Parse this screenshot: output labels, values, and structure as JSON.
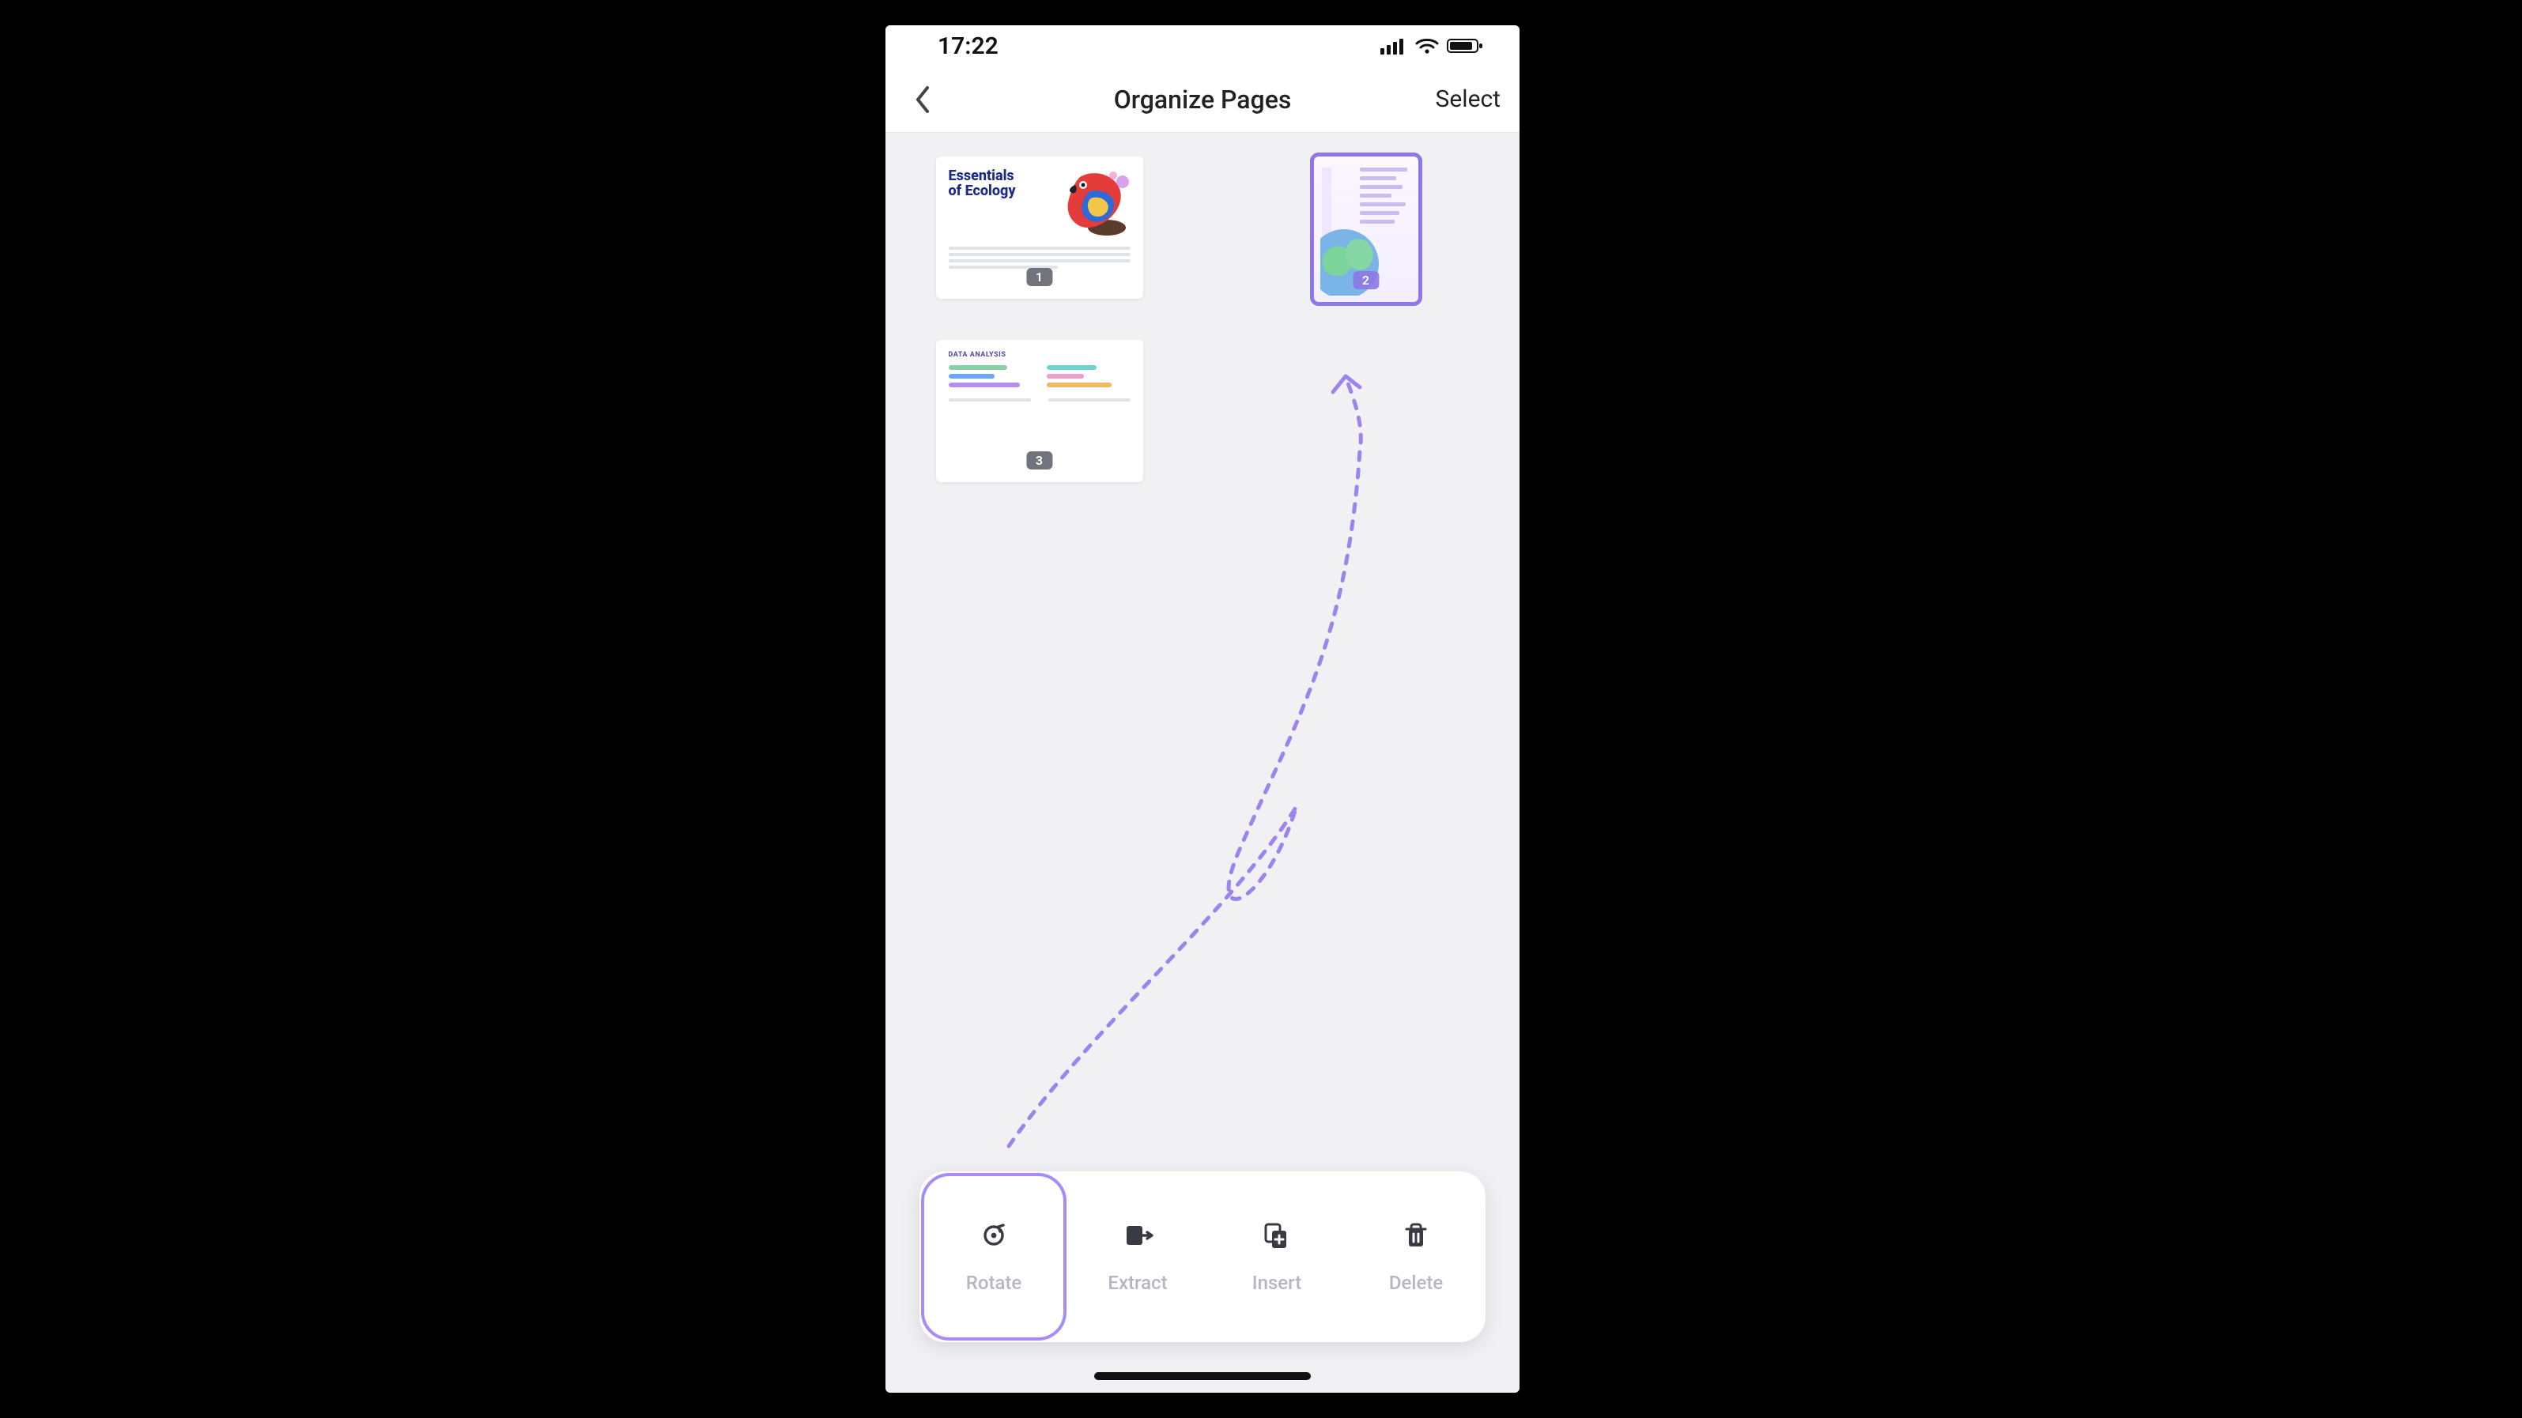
{
  "status": {
    "time": "17:22"
  },
  "nav": {
    "title": "Organize Pages",
    "action": "Select"
  },
  "pages": [
    {
      "number": "1",
      "title": "Essentials\nof Ecology",
      "orientation": "landscape",
      "selected": false
    },
    {
      "number": "2",
      "title": "",
      "orientation": "portrait",
      "selected": true
    },
    {
      "number": "3",
      "title": "DATA ANALYSIS",
      "orientation": "landscape",
      "selected": false
    }
  ],
  "toolbar": {
    "rotate": "Rotate",
    "extract": "Extract",
    "insert": "Insert",
    "delete": "Delete",
    "highlighted": "rotate"
  },
  "colors": {
    "accent": "#8e77e6"
  }
}
